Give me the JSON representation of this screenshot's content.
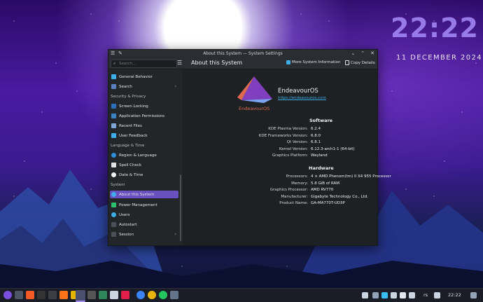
{
  "clock": {
    "time": "22:22",
    "date": "11 DECEMBER 2024"
  },
  "window": {
    "title": "About this System — System Settings",
    "search_placeholder": "Search...",
    "page_title": "About this System",
    "more_info_label": "More System Information",
    "copy_label": "Copy Details"
  },
  "sidebar": {
    "items": [
      {
        "label": "General Behavior"
      },
      {
        "label": "Search"
      },
      {
        "label": "Screen Locking"
      },
      {
        "label": "Application Permissions"
      },
      {
        "label": "Recent Files"
      },
      {
        "label": "User Feedback"
      },
      {
        "label": "Region & Language"
      },
      {
        "label": "Spell Check"
      },
      {
        "label": "Date & Time"
      },
      {
        "label": "About this System"
      },
      {
        "label": "Power Management"
      },
      {
        "label": "Users"
      },
      {
        "label": "Autostart"
      },
      {
        "label": "Session"
      }
    ],
    "sections": [
      {
        "label": "Security & Privacy"
      },
      {
        "label": "Language & Time"
      },
      {
        "label": "System"
      }
    ]
  },
  "about": {
    "logo_text": "EndeavourOS",
    "distro_name": "EndeavourOS",
    "distro_url": "https://endeavouros.com",
    "software_header": "Software",
    "hardware_header": "Hardware",
    "software": [
      {
        "label": "KDE Plasma Version:",
        "value": "6.2.4"
      },
      {
        "label": "KDE Frameworks Version:",
        "value": "6.8.0"
      },
      {
        "label": "Qt Version:",
        "value": "6.8.1"
      },
      {
        "label": "Kernel Version:",
        "value": "6.12.3-arch1-1 (64-bit)"
      },
      {
        "label": "Graphics Platform:",
        "value": "Wayland"
      }
    ],
    "hardware": [
      {
        "label": "Processors:",
        "value": "4 × AMD Phenom(tm) II X4 955 Processor"
      },
      {
        "label": "Memory:",
        "value": "5.8 GiB of RAM"
      },
      {
        "label": "Graphics Processor:",
        "value": "AMD RV770"
      },
      {
        "label": "Manufacturer:",
        "value": "Gigabyte Technology Co., Ltd."
      },
      {
        "label": "Product Name:",
        "value": "GA-MA770T-UD3P"
      }
    ]
  },
  "taskbar": {
    "keyboard_layout": "rs",
    "time": "22:22"
  }
}
